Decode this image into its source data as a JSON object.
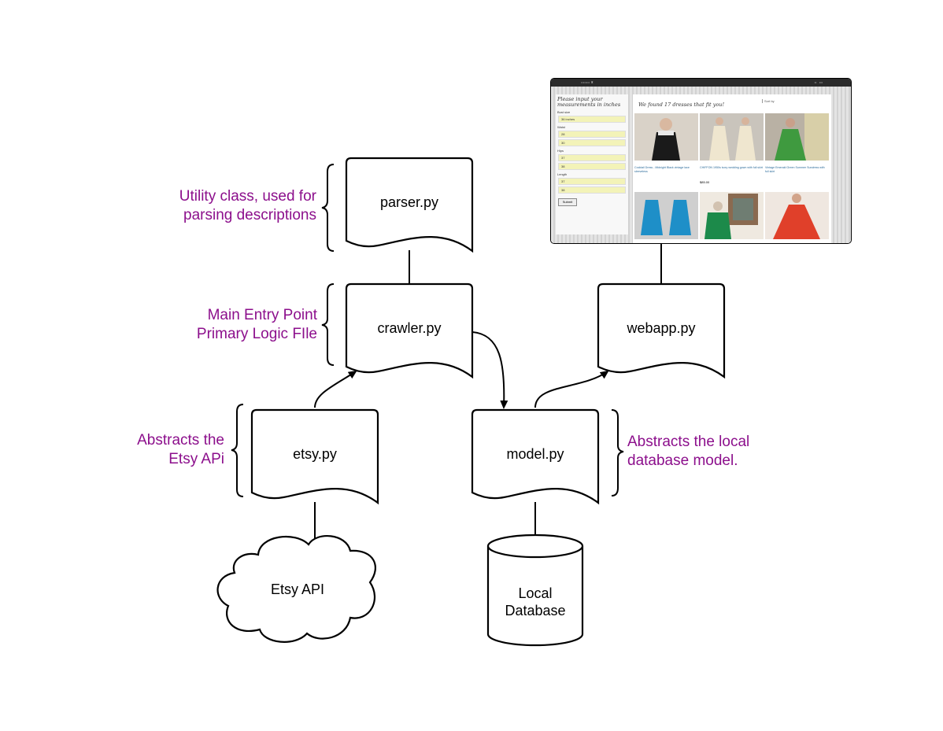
{
  "diagram": {
    "files": {
      "parser": "parser.py",
      "crawler": "crawler.py",
      "webapp": "webapp.py",
      "etsy": "etsy.py",
      "model": "model.py"
    },
    "cloud_label": "Etsy API",
    "database_label_line1": "Local",
    "database_label_line2": "Database",
    "notes": {
      "parser_line1": "Utility class, used for",
      "parser_line2": "parsing descriptions",
      "crawler_line1": "Main Entry Point",
      "crawler_line2": "Primary Logic FIle",
      "etsy_line1": "Abstracts the",
      "etsy_line2": "Etsy APi",
      "model_line1": "Abstracts the local",
      "model_line2": "database model."
    },
    "colors": {
      "note_text": "#8c0f8c",
      "stroke": "#000000"
    }
  },
  "webapp_screenshot": {
    "form_title": "Please input your measurements in inches",
    "fields": [
      {
        "label": "Bust size",
        "value": "36 inches"
      },
      {
        "label": "Waist",
        "value": "28"
      },
      {
        "label": "",
        "value": "30"
      },
      {
        "label": "Hips",
        "value": "37"
      },
      {
        "label": "",
        "value": "38"
      },
      {
        "label": "Length",
        "value": "37"
      },
      {
        "label": "",
        "value": "38"
      }
    ],
    "submit_label": "Submit",
    "results_heading": "We found 17 dresses that fit you!",
    "sort_label": "Sort by",
    "tiles": [
      {
        "caption": "Cocktail Dress - Midnight Black vintage lace sleeveless",
        "price": "",
        "color": "#1a1a1a",
        "bg": "#d9d2c8"
      },
      {
        "caption": "CHIFFON 1950s ivory wedding gown with full skirt",
        "price": "$85.00",
        "color": "#efe6cf",
        "bg": "#c9c4bc"
      },
      {
        "caption": "Vintage Emerald Green Summer Sundress with full skirt",
        "price": "",
        "color": "#3f9a3f",
        "bg": "#b9b1a4"
      },
      {
        "caption": "",
        "price": "",
        "color": "#1e8fc8",
        "bg": "#cfcfcf"
      },
      {
        "caption": "",
        "price": "",
        "color": "#1c8a4a",
        "bg": "#8a6a50"
      },
      {
        "caption": "",
        "price": "",
        "color": "#e0402a",
        "bg": "#efe7e0"
      }
    ]
  }
}
